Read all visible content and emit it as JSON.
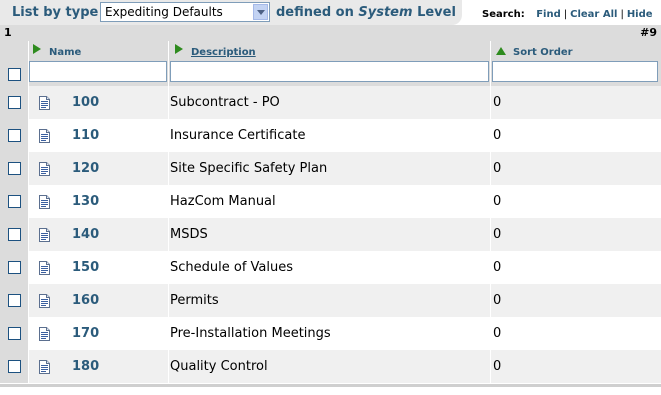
{
  "header": {
    "list_by_type_label": "List by type",
    "type_select_value": "Expediting Defaults",
    "defined_on_prefix": "defined on",
    "defined_on_level": "System",
    "defined_on_suffix": "Level",
    "search_label": "Search:",
    "find_label": "Find",
    "clear_all_label": "Clear All",
    "hide_label": "Hide"
  },
  "pager": {
    "page": "1",
    "count": "#9"
  },
  "columns": {
    "name": "Name",
    "description": "Description",
    "sort_order": "Sort Order"
  },
  "filters": {
    "name": "",
    "description": "",
    "sort_order": ""
  },
  "rows": [
    {
      "name": "100",
      "description": "Subcontract - PO",
      "sort_order": "0"
    },
    {
      "name": "110",
      "description": "Insurance Certificate",
      "sort_order": "0"
    },
    {
      "name": "120",
      "description": "Site Specific Safety Plan",
      "sort_order": "0"
    },
    {
      "name": "130",
      "description": "HazCom Manual",
      "sort_order": "0"
    },
    {
      "name": "140",
      "description": "MSDS",
      "sort_order": "0"
    },
    {
      "name": "150",
      "description": "Schedule of Values",
      "sort_order": "0"
    },
    {
      "name": "160",
      "description": "Permits",
      "sort_order": "0"
    },
    {
      "name": "170",
      "description": "Pre-Installation Meetings",
      "sort_order": "0"
    },
    {
      "name": "180",
      "description": "Quality Control",
      "sort_order": "0"
    }
  ],
  "colors": {
    "link": "#2b5b7b",
    "header_gray": "#dcdcdc",
    "row_alt": "#f0f0f0",
    "sort_arrow": "#2e8b1e"
  }
}
